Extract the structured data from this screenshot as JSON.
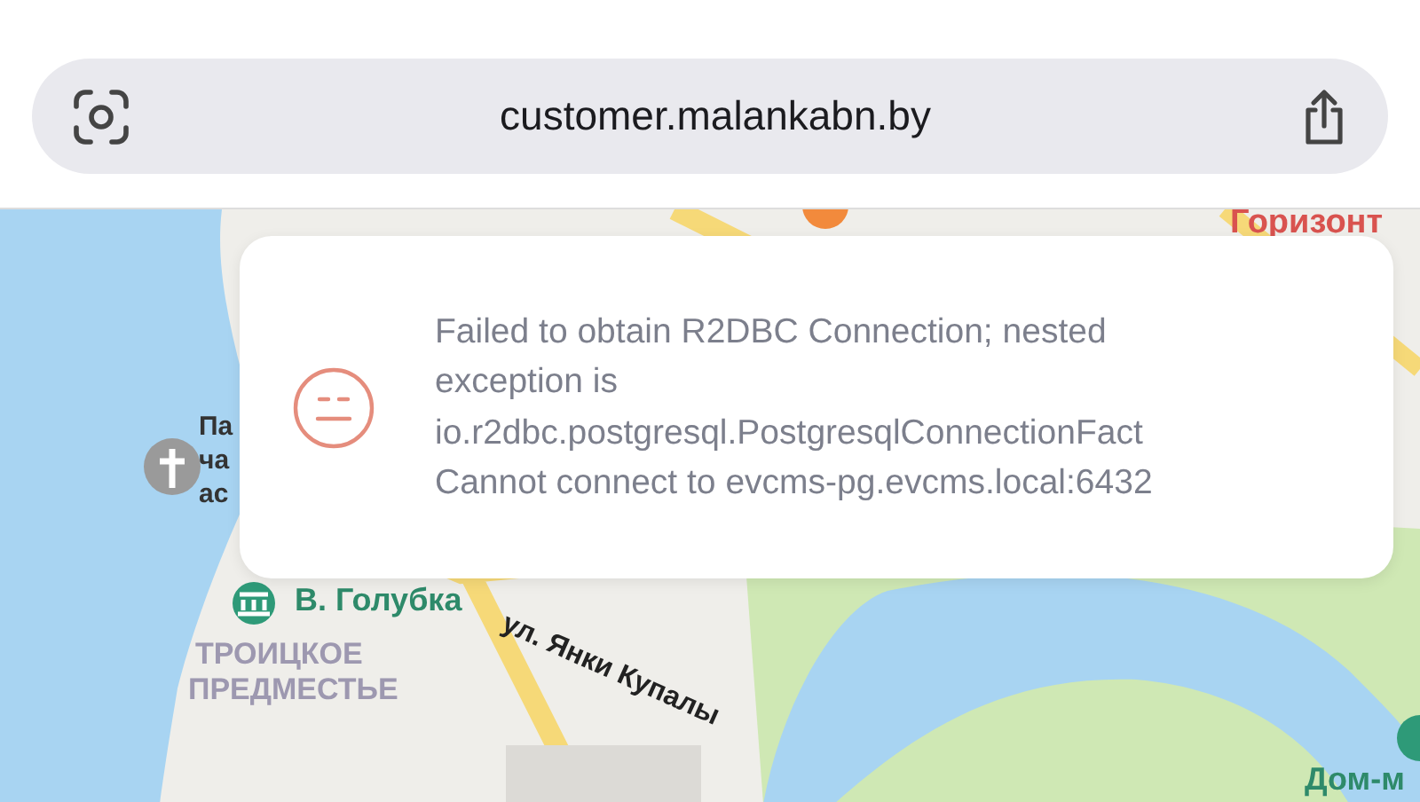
{
  "address_bar": {
    "url": "customer.malankabn.by"
  },
  "map": {
    "labels": [
      {
        "kind": "place",
        "text": "Горизонт"
      },
      {
        "kind": "poi",
        "text": "Па"
      },
      {
        "kind": "poi",
        "text": "ча"
      },
      {
        "kind": "poi",
        "text": "ас"
      },
      {
        "kind": "transit",
        "text": "В. Голубка"
      },
      {
        "kind": "district",
        "text": "ТРОИЦКОЕ"
      },
      {
        "kind": "district",
        "text": "ПРЕДМЕСТЬЕ"
      },
      {
        "kind": "street",
        "text": "ул. Янки Купалы"
      },
      {
        "kind": "transit",
        "text": "Дом-м"
      }
    ]
  },
  "toast": {
    "message": "Failed to obtain R2DBC Connection; nested exception is io.r2dbc.postgresql.PostgresqlConnectionFact Cannot connect to evcms-pg.evcms.local:6432"
  }
}
